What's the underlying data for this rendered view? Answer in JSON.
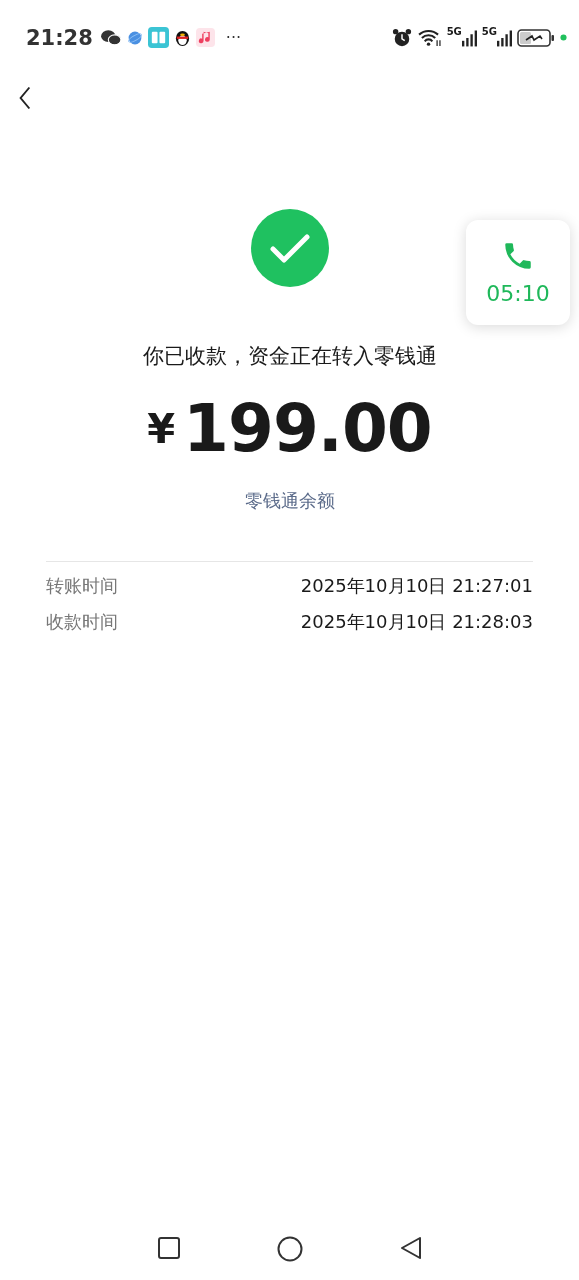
{
  "status_bar": {
    "time": "21:28",
    "more": "···",
    "signals": [
      "5G",
      "5G"
    ]
  },
  "message": "你已收款，资金正在转入零钱通",
  "amount": {
    "currency": "¥",
    "value": "199.00"
  },
  "balance_link": "零钱通余额",
  "details": [
    {
      "label": "转账时间",
      "value": "2025年10月10日 21:27:01"
    },
    {
      "label": "收款时间",
      "value": "2025年10月10日 21:28:03"
    }
  ],
  "call_bubble": {
    "duration": "05:10"
  }
}
